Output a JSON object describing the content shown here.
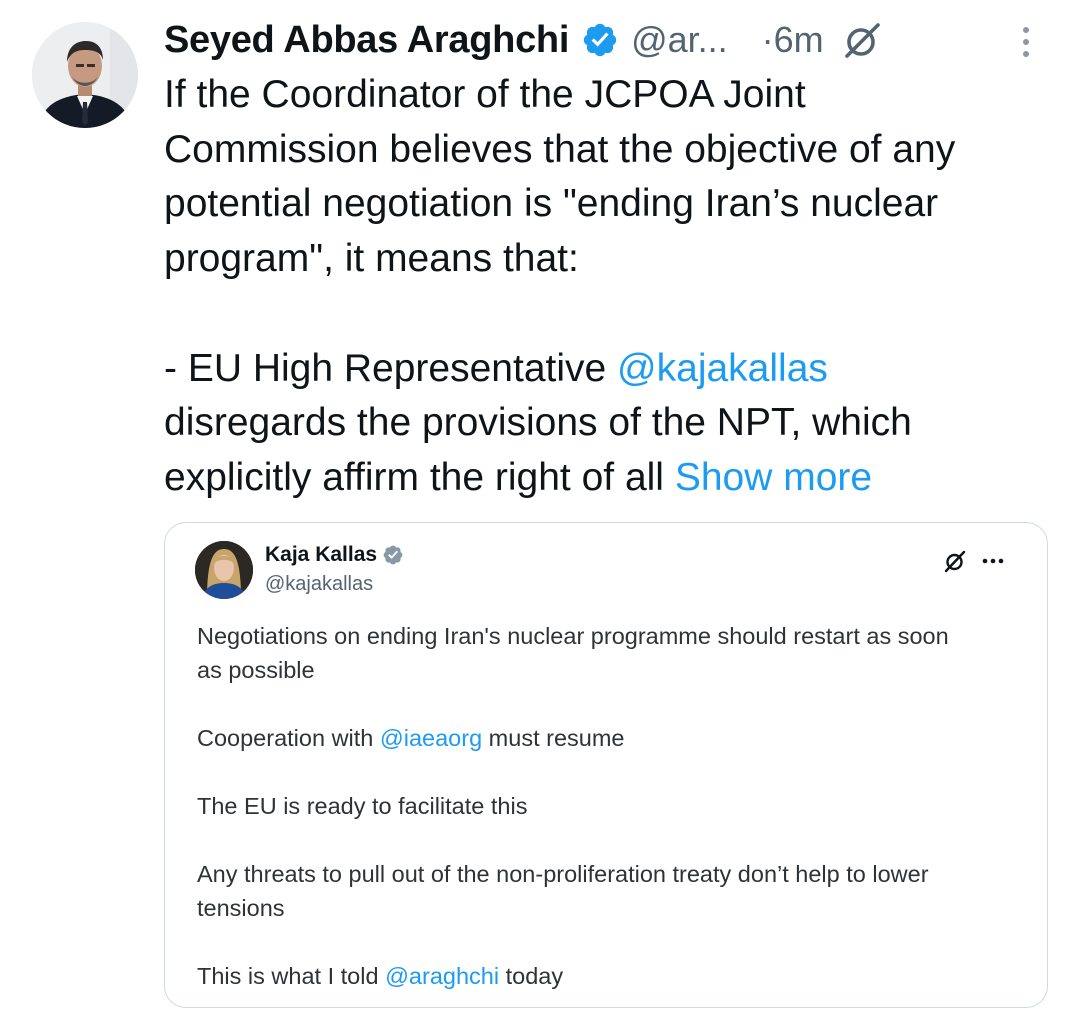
{
  "tweet": {
    "author_name": "Seyed Abbas Araghchi",
    "handle": "@ar...",
    "time": "·6m",
    "lines": [
      "If the Coordinator of the JCPOA Joint",
      "Commission believes that the objective of any",
      "potential negotiation is \"ending Iran’s nuclear",
      "program\", it means that:"
    ],
    "bullet_prefix": "- EU High Representative ",
    "mention": "@kajakallas",
    "line6": "disregards the provisions of the NPT, which",
    "line7": "explicitly affirm the right of all ",
    "show_more": "Show more"
  },
  "quote": {
    "author_name": "Kaja Kallas",
    "handle": "@kajakallas",
    "p1_line1": "Negotiations on ending Iran's nuclear programme should restart as soon",
    "p1_line2": "as possible",
    "p2_prefix": "Cooperation with ",
    "p2_mention": "@iaeaorg",
    "p2_suffix": " must resume",
    "p3": "The EU is ready to facilitate this",
    "p4_line1": "Any threats to pull out of the non-proliferation treaty don’t help to lower",
    "p4_line2": "tensions",
    "p5_prefix": "This is what I told ",
    "p5_mention": "@araghchi",
    "p5_suffix": " today"
  },
  "colors": {
    "link": "#1d9bf0",
    "verified": "#1d9bf0",
    "secondary_text": "#536471",
    "border": "#cfd9de"
  },
  "icons": [
    "verified-badge-icon",
    "grok-icon",
    "more-vertical-icon",
    "more-horizontal-icon"
  ]
}
